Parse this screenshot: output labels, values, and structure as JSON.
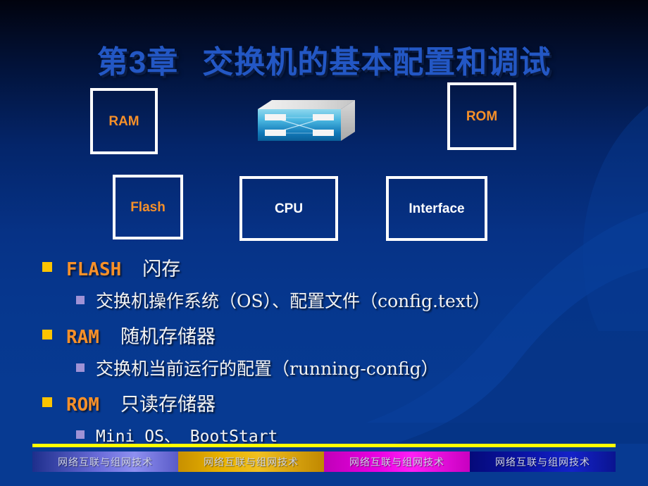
{
  "slide": {
    "title_chapter": "第3章",
    "title_main": "交换机的基本配置和调试",
    "background_color": "#073a92",
    "accent_orange": "#f79029",
    "accent_yellow": "#fcc400",
    "title_color": "#2357c4"
  },
  "diagram": {
    "boxes": [
      {
        "id": "ram",
        "label": "RAM",
        "color": "#f79029"
      },
      {
        "id": "rom",
        "label": "ROM",
        "color": "#f79029"
      },
      {
        "id": "flash",
        "label": "Flash",
        "color": "#f79029"
      },
      {
        "id": "cpu",
        "label": "CPU",
        "color": "#ffffff"
      },
      {
        "id": "interface",
        "label": "Interface",
        "color": "#ffffff"
      }
    ],
    "switch_icon": "network-switch-icon"
  },
  "bullets": [
    {
      "term": "FLASH",
      "desc": "闪存",
      "sub": "交换机操作系统（OS）、配置文件（config.text）"
    },
    {
      "term": "RAM",
      "desc": "随机存储器",
      "sub": "交换机当前运行的配置（running-config）"
    },
    {
      "term": "ROM",
      "desc": "只读存储器",
      "sub": "Mini OS、 BootStart"
    }
  ],
  "footer": {
    "rule_color": "#ffff00",
    "segments": [
      {
        "label": "网络互联与组网技术",
        "color": "#6a6bd8"
      },
      {
        "label": "网络互联与组网技术",
        "color": "#e8b200"
      },
      {
        "label": "网络互联与组网技术",
        "color": "#e800e0"
      },
      {
        "label": "网络互联与组网技术",
        "color": "#0b14a8"
      }
    ]
  }
}
